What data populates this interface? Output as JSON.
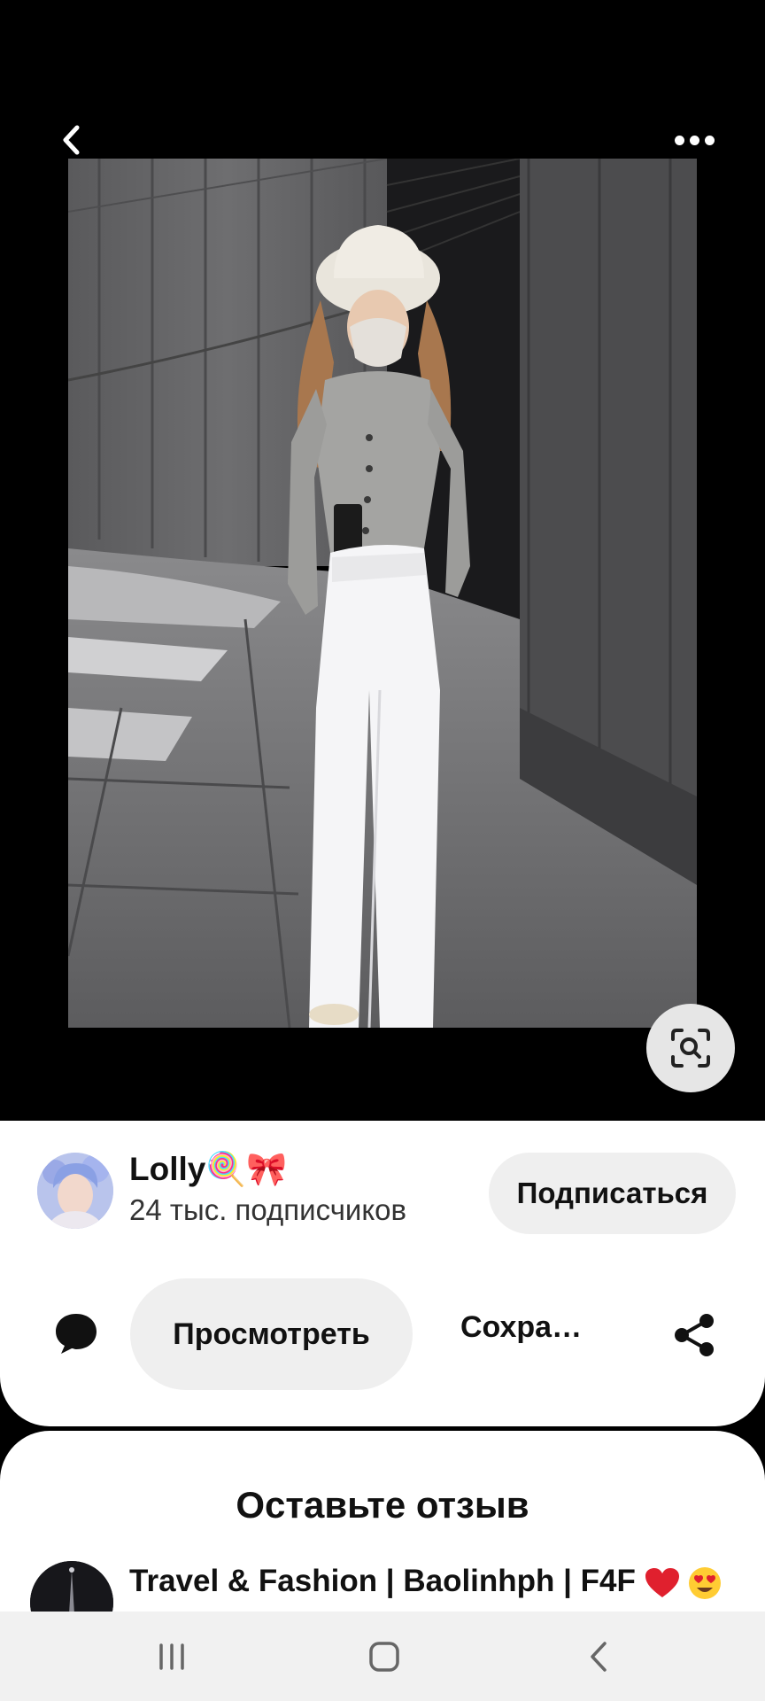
{
  "top_bar": {
    "back_icon": "chevron-left-icon",
    "more_icon": "more-horizontal-icon"
  },
  "image": {
    "description_icon": "visual-search-icon"
  },
  "author": {
    "name": "Lolly🍭🎀",
    "followers": "24 тыс. подписчиков",
    "subscribe_label": "Подписаться"
  },
  "actions": {
    "comment_icon": "comment-icon",
    "view_label": "Просмотреть",
    "save_label": "Сохра…",
    "share_icon": "share-icon"
  },
  "reviews": {
    "title": "Оставьте отзыв",
    "board_name": "Travel & Fashion | Baolinhph | F4F"
  },
  "nav": {
    "recents_icon": "recents-icon",
    "home_icon": "home-icon",
    "back_icon": "back-icon"
  },
  "colors": {
    "background": "#000000",
    "card": "#ffffff",
    "pill": "#efefef",
    "heart": "#e0202e"
  }
}
